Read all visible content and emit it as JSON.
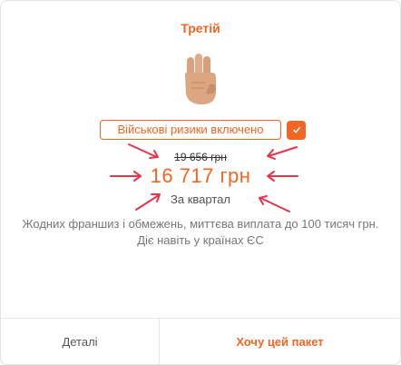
{
  "card": {
    "title": "Третій",
    "hand_icon": "three-fingers-hand-icon",
    "badge_label": "Військові ризики включено",
    "old_price": "19 656 грн",
    "price": "16 717 грн",
    "period": "За квартал",
    "description": "Жодних франшиз і обмежень, миттєва виплата до 100 тисяч грн. Діє навіть у країнах ЄС"
  },
  "footer": {
    "details_label": "Деталі",
    "buy_label": "Хочу цей пакет"
  },
  "colors": {
    "accent": "#f26522",
    "annotation_arrows": "#e8334a"
  }
}
